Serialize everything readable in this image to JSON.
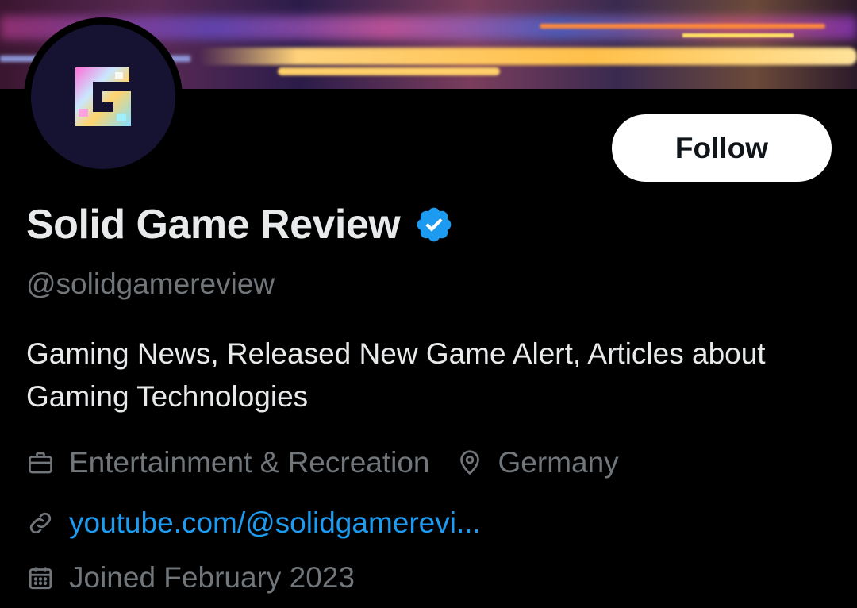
{
  "profile": {
    "display_name": "Solid Game Review",
    "handle": "@solidgamereview",
    "bio": "Gaming News, Released New Game Alert, Articles about Gaming Technologies",
    "verified": true,
    "category": "Entertainment & Recreation",
    "location": "Germany",
    "website": "youtube.com/@solidgamerevi...",
    "joined": "Joined February 2023"
  },
  "actions": {
    "follow_label": "Follow"
  },
  "colors": {
    "background": "#000000",
    "primary_text": "#e7e9ea",
    "secondary_text": "#71767b",
    "link": "#1d9bf0",
    "verified_badge": "#1d9bf0",
    "follow_bg": "#ffffff"
  },
  "icons": {
    "verified": "verified-badge-icon",
    "category": "briefcase-icon",
    "location": "location-pin-icon",
    "website": "link-icon",
    "joined": "calendar-icon"
  }
}
